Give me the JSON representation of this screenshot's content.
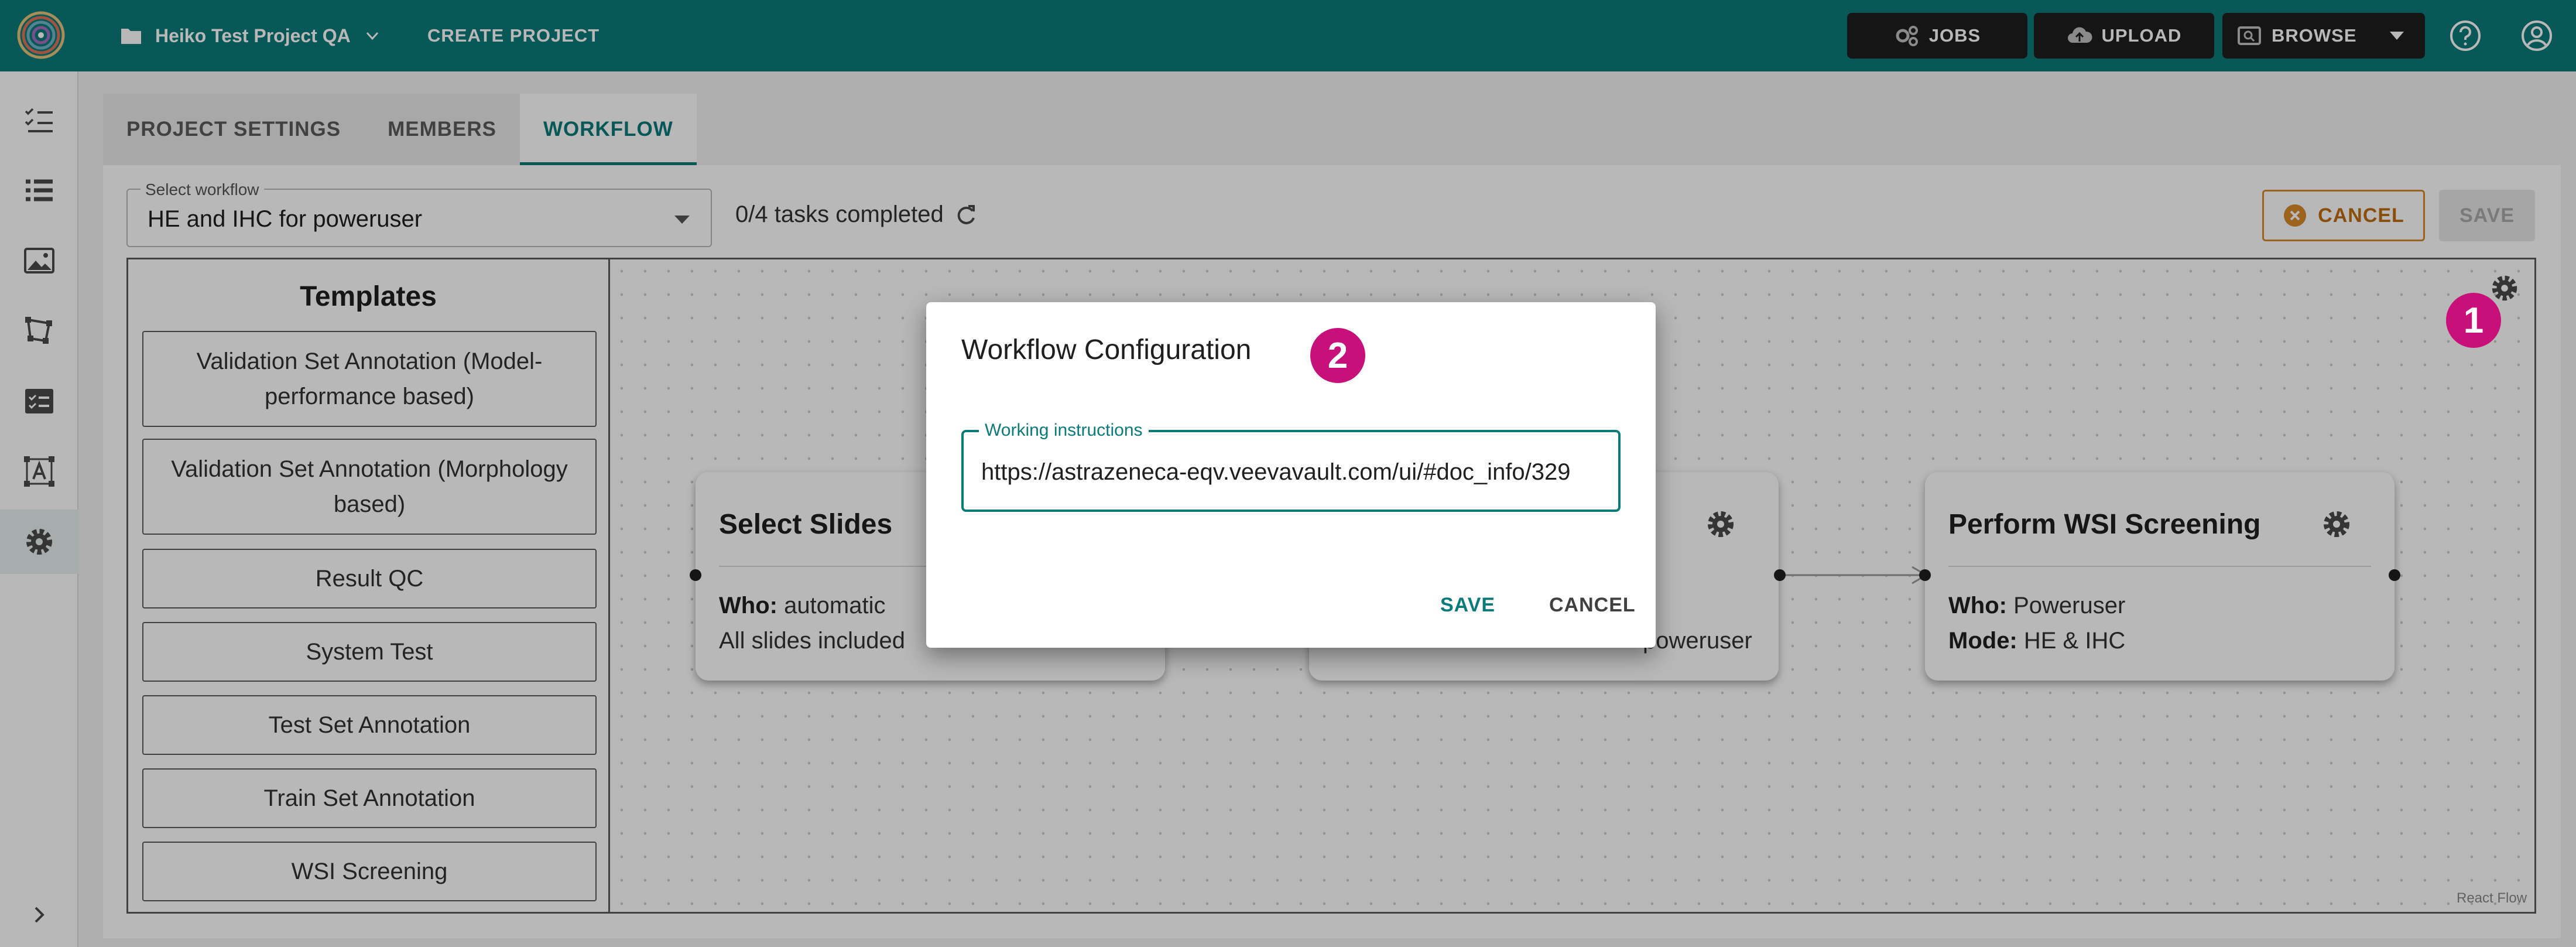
{
  "header": {
    "project_name": "Heiko Test Project QA",
    "create_project": "CREATE PROJECT",
    "jobs": "JOBS",
    "upload": "UPLOAD",
    "browse": "BROWSE"
  },
  "tabs": [
    {
      "label": "PROJECT SETTINGS"
    },
    {
      "label": "MEMBERS"
    },
    {
      "label": "WORKFLOW"
    }
  ],
  "workflow": {
    "select_label": "Select workflow",
    "select_value": "HE and IHC for poweruser",
    "tasks_completed": "0/4 tasks completed",
    "cancel": "CANCEL",
    "save": "SAVE"
  },
  "templates": {
    "title": "Templates",
    "items": [
      "Validation Set Annotation (Model-performance based)",
      "Validation Set Annotation (Morphology based)",
      "Result QC",
      "System Test",
      "Test Set Annotation",
      "Train Set Annotation",
      "WSI Screening"
    ]
  },
  "nodes": [
    {
      "title": "Select Slides",
      "line1_key": "Who:",
      "line1_val": " automatic",
      "line2": "All slides included"
    },
    {
      "title": "",
      "line1_key": "",
      "line1_val": "",
      "line2": "poweruser"
    },
    {
      "title": "Perform WSI Screening",
      "line1_key": "Who:",
      "line1_val": " Poweruser",
      "line2_key": "Mode:",
      "line2_val": " HE & IHC"
    }
  ],
  "canvas": {
    "attribution": "React Flow"
  },
  "dialog": {
    "title": "Workflow Configuration",
    "field_label": "Working instructions",
    "field_value": "https://astrazeneca-eqv.veevavault.com/ui/#doc_info/329",
    "save": "SAVE",
    "cancel": "CANCEL"
  },
  "markers": {
    "one": "1",
    "two": "2"
  },
  "colors": {
    "brand": "#0a7b79",
    "marker": "#c8107a",
    "cancel_accent": "#d98a2b"
  },
  "icons": {
    "sidebar": [
      "checklist-icon",
      "list-icon",
      "image-icon",
      "annotation-icon",
      "task-icon",
      "text-frame-icon",
      "gear-icon"
    ]
  }
}
